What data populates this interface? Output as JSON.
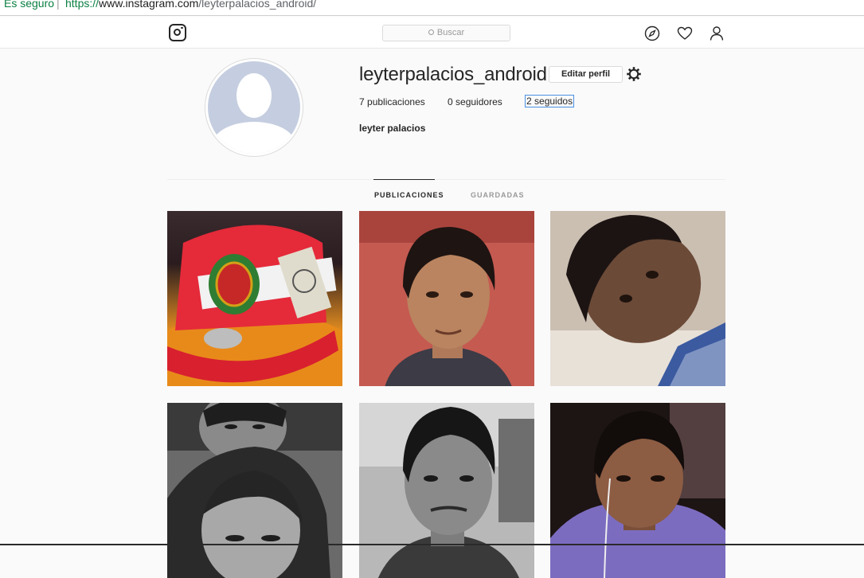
{
  "browser": {
    "secure_label": "Es seguro",
    "separator": "|",
    "url_scheme": "https://",
    "url_host": "www.instagram.com",
    "url_path": "/leyterpalacios_android/"
  },
  "nav": {
    "search_placeholder": "Buscar",
    "icons": [
      "instagram-logo-icon",
      "compass-icon",
      "heart-icon",
      "user-icon"
    ]
  },
  "profile": {
    "username": "leyterpalacios_android",
    "edit_label": "Editar perfil",
    "posts_count": "7",
    "posts_label": "publicaciones",
    "followers_count": "0",
    "followers_label": "seguidores",
    "following_count": "2",
    "following_label": "seguidos",
    "full_name": "leyter palacios"
  },
  "tabs": {
    "posts": "PUBLICACIONES",
    "saved": "GUARDADAS",
    "active": "posts"
  },
  "grid": {
    "posts": [
      {
        "subject": "red cap photo"
      },
      {
        "subject": "man portrait red background"
      },
      {
        "subject": "man selfie tilted"
      },
      {
        "subject": "couple black and white"
      },
      {
        "subject": "man black and white portrait"
      },
      {
        "subject": "man selfie in car"
      }
    ]
  },
  "colors": {
    "secure": "#0b8043",
    "text": "#262626",
    "muted": "#999999",
    "border": "#dbdbdb",
    "focus": "#4a90e2"
  }
}
